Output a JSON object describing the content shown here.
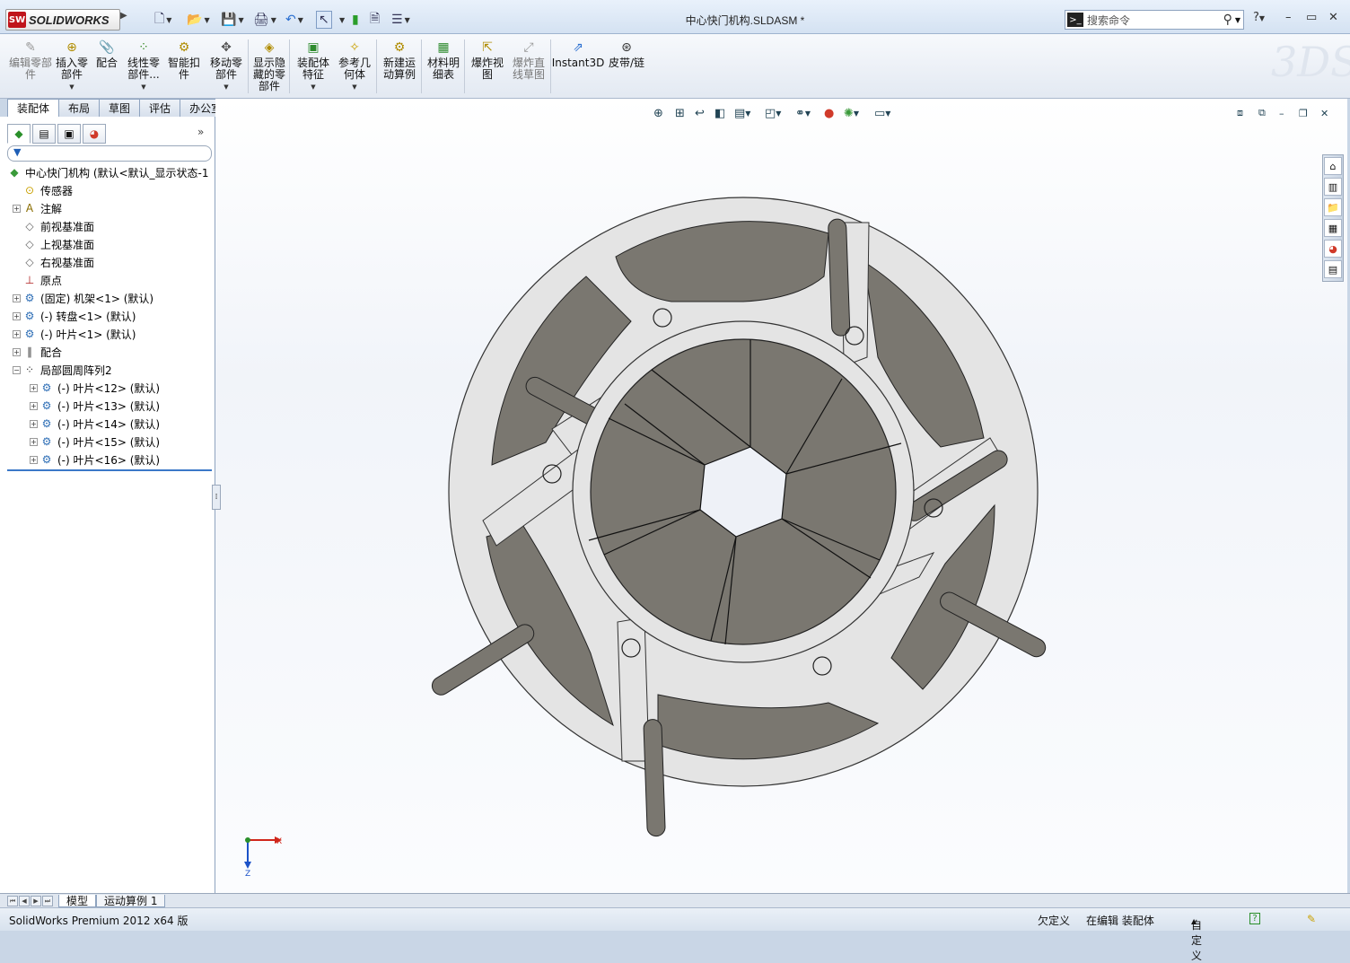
{
  "app": {
    "logo_text": "SOLIDWORKS",
    "logo_badge": "SW",
    "document_title": "中心快门机构.SLDASM *",
    "search_placeholder": "搜索命令",
    "help": "?"
  },
  "ribbon": {
    "buttons": [
      {
        "label": "编辑零部件",
        "enabled": false
      },
      {
        "label": "插入零部件",
        "enabled": true
      },
      {
        "label": "配合",
        "enabled": true
      },
      {
        "label": "线性零部件...",
        "enabled": true
      },
      {
        "label": "智能扣件",
        "enabled": true
      },
      {
        "label": "移动零部件",
        "enabled": true
      },
      {
        "label": "显示隐藏的零部件",
        "enabled": true
      },
      {
        "label": "装配体特征",
        "enabled": true
      },
      {
        "label": "参考几何体",
        "enabled": true
      },
      {
        "label": "新建运动算例",
        "enabled": true
      },
      {
        "label": "材料明细表",
        "enabled": true
      },
      {
        "label": "爆炸视图",
        "enabled": true
      },
      {
        "label": "爆炸直线草图",
        "enabled": false
      },
      {
        "label": "Instant3D",
        "enabled": true
      },
      {
        "label": "皮带/链",
        "enabled": true
      }
    ]
  },
  "command_tabs": [
    "装配体",
    "布局",
    "草图",
    "评估",
    "办公室产品"
  ],
  "feature_tree": {
    "root": "中心快门机构  (默认<默认_显示状态-1",
    "items": [
      {
        "label": "传感器",
        "icon": "sensor-icon",
        "expandable": false,
        "indent": 1
      },
      {
        "label": "注解",
        "icon": "annotation-icon",
        "expandable": true,
        "indent": 1
      },
      {
        "label": "前视基准面",
        "icon": "plane-icon",
        "expandable": false,
        "indent": 1
      },
      {
        "label": "上视基准面",
        "icon": "plane-icon",
        "expandable": false,
        "indent": 1
      },
      {
        "label": "右视基准面",
        "icon": "plane-icon",
        "expandable": false,
        "indent": 1
      },
      {
        "label": "原点",
        "icon": "origin-icon",
        "expandable": false,
        "indent": 1
      },
      {
        "label": "(固定) 机架<1> (默认)",
        "icon": "part-icon",
        "expandable": true,
        "indent": 1
      },
      {
        "label": "(-) 转盘<1> (默认)",
        "icon": "part-icon",
        "expandable": true,
        "indent": 1
      },
      {
        "label": "(-) 叶片<1> (默认)",
        "icon": "part-icon",
        "expandable": true,
        "indent": 1
      },
      {
        "label": "配合",
        "icon": "mates-icon",
        "expandable": true,
        "indent": 1
      },
      {
        "label": "局部圆周阵列2",
        "icon": "pattern-icon",
        "expandable": true,
        "expanded": true,
        "indent": 1
      },
      {
        "label": "(-) 叶片<12> (默认)",
        "icon": "part-icon",
        "expandable": true,
        "indent": 2
      },
      {
        "label": "(-) 叶片<13> (默认)",
        "icon": "part-icon",
        "expandable": true,
        "indent": 2
      },
      {
        "label": "(-) 叶片<14> (默认)",
        "icon": "part-icon",
        "expandable": true,
        "indent": 2
      },
      {
        "label": "(-) 叶片<15> (默认)",
        "icon": "part-icon",
        "expandable": true,
        "indent": 2
      },
      {
        "label": "(-) 叶片<16> (默认)",
        "icon": "part-icon",
        "expandable": true,
        "indent": 2
      }
    ]
  },
  "triad": {
    "x_label": "X",
    "z_label": "Z"
  },
  "bottom_tabs": [
    "模型",
    "运动算例 1"
  ],
  "status": {
    "product": "SolidWorks Premium 2012 x64 版",
    "definition": "欠定义",
    "editing": "在编辑 装配体",
    "units": "自定义",
    "units_caret": "▲",
    "help_badge": "?"
  },
  "colors": {
    "model_face": "#7a7770",
    "model_rim": "#e4e4e4",
    "selection_blue": "#3b78c8"
  }
}
